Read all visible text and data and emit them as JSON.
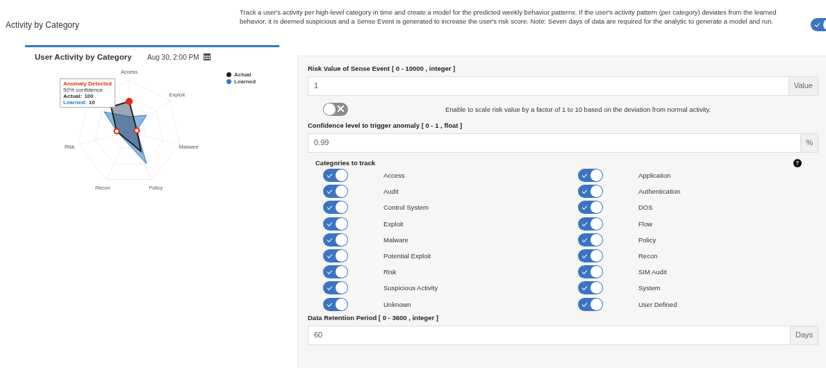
{
  "page_title": "Activity by Category",
  "description": "Track a user's activity per high-level category in time and create a model for the predicted weekly behavior patterns. If the user's activity pattern (per category) deviates from the learned behavior, it is deemed suspicious and a Sense Event is generated to increase the user's risk score. Note: Seven days of data are required for the analytic to generate a model and run.",
  "enabled_toggle": {
    "on": true
  },
  "chart": {
    "title": "User Activity by Category",
    "date": "Aug 30, 2:00 PM",
    "axes": [
      "Access",
      "Exploit",
      "Malware",
      "Policy",
      "Recon",
      "Risk"
    ],
    "legend": [
      {
        "label": "Actual",
        "color": "#222222"
      },
      {
        "label": "Learned",
        "color": "#2d7bc4"
      }
    ],
    "tooltip": {
      "heading": "Anomaly Detected",
      "confidence": "50% confidence",
      "actual_label": "Actual:",
      "actual_value": "100",
      "learned_label": "Learned:",
      "learned_value": "10"
    }
  },
  "risk_value": {
    "label": "Risk Value of Sense Event [ 0 - 10000 , integer ]",
    "value": "1",
    "addon": "Value"
  },
  "scale_toggle": {
    "on": false,
    "label": "Enable to scale risk value by a factor of 1 to 10 based on the deviation from normal activity."
  },
  "confidence": {
    "label": "Confidence level to trigger anomaly [ 0 - 1 , float ]",
    "value": "0.99",
    "addon": "%"
  },
  "categories": {
    "title": "Categories to track",
    "help": "?",
    "items": [
      {
        "label": "Access",
        "on": true
      },
      {
        "label": "Application",
        "on": true
      },
      {
        "label": "Audit",
        "on": true
      },
      {
        "label": "Authentication",
        "on": true
      },
      {
        "label": "Control System",
        "on": true
      },
      {
        "label": "DOS",
        "on": true
      },
      {
        "label": "Exploit",
        "on": true
      },
      {
        "label": "Flow",
        "on": true
      },
      {
        "label": "Malware",
        "on": true
      },
      {
        "label": "Policy",
        "on": true
      },
      {
        "label": "Potential Exploit",
        "on": true
      },
      {
        "label": "Recon",
        "on": true
      },
      {
        "label": "Risk",
        "on": true
      },
      {
        "label": "SIM Audit",
        "on": true
      },
      {
        "label": "Suspicious Activity",
        "on": true
      },
      {
        "label": "System",
        "on": true
      },
      {
        "label": "Unknown",
        "on": true
      },
      {
        "label": "User Defined",
        "on": true
      }
    ]
  },
  "retention": {
    "label": "Data Retention Period [ 0 - 3600 , integer ]",
    "value": "60",
    "addon": "Days"
  }
}
